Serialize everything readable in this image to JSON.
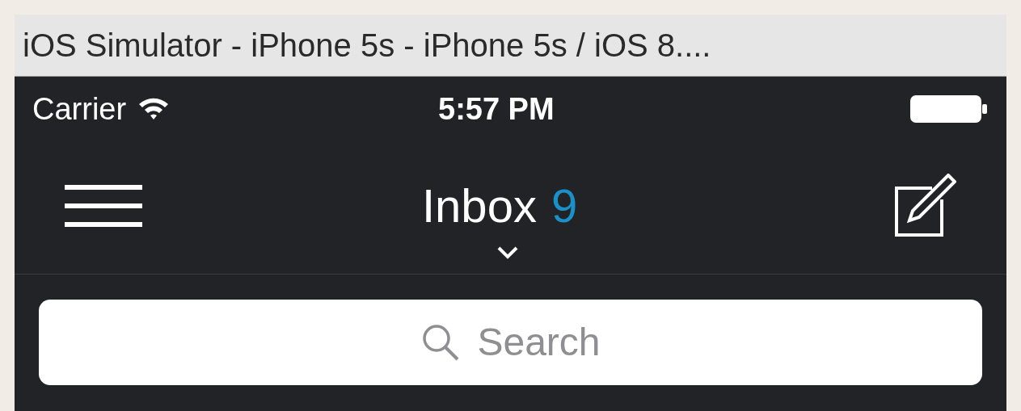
{
  "window": {
    "title": "iOS Simulator - iPhone 5s - iPhone 5s / iOS 8...."
  },
  "status_bar": {
    "carrier": "Carrier",
    "time": "5:57 PM"
  },
  "nav": {
    "title": "Inbox",
    "count": "9"
  },
  "search": {
    "placeholder": "Search"
  }
}
